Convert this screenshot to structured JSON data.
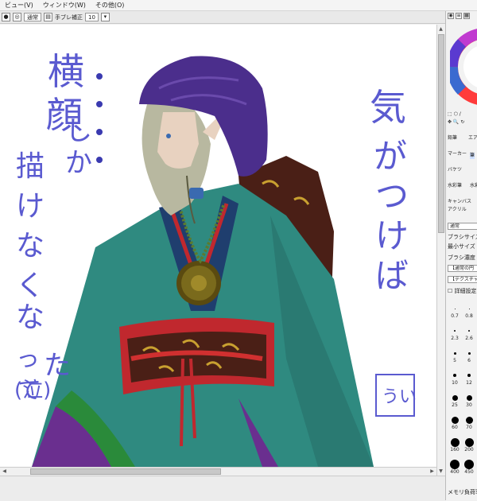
{
  "menu": {
    "items": [
      "ビュー(V)",
      "ウィンドウ(W)",
      "その他(O)"
    ]
  },
  "toolbar": {
    "blend_mode": "通常",
    "stabilizer_label": "手ブレ補正",
    "stabilizer_value": "10"
  },
  "canvas": {
    "left_text_col1": "横顔・・・",
    "left_text_col2": "しか・・・",
    "left_text_col3": "描けなくなってた",
    "left_text_col4": "(泣)",
    "right_text": "気がつけば",
    "signature": "うい"
  },
  "panel": {
    "tools": [
      {
        "label": "鉛筆"
      },
      {
        "label": "エア"
      },
      {
        "label": "マーカー"
      },
      {
        "label": "筆"
      },
      {
        "label": "バケツ"
      },
      {
        "label": "水彩筆"
      },
      {
        "label": "水彩"
      },
      {
        "label": "キャンバス"
      },
      {
        "label": "アクリル"
      }
    ],
    "blend_field": "通常",
    "brush_size_label": "ブラシサイズ",
    "min_size_label": "最小サイズ",
    "brush_density_label": "ブラシ濃度",
    "shape_field": "【通常の円",
    "texture_field": "【テクスチャ",
    "detail_label": "詳細設定",
    "sizes": [
      "0.7",
      "0.8",
      "2.3",
      "2.6",
      "5",
      "6",
      "10",
      "12",
      "25",
      "30",
      "60",
      "70",
      "160",
      "200",
      "400",
      "450"
    ],
    "memory_label": "メモリ負荷率"
  },
  "colors": {
    "menubar_bg": "#f4f4f4",
    "text_ink": "#3a3ab0",
    "turban": "#4b2e8c",
    "robe": "#2f8a80",
    "obi_red": "#c0282e",
    "obi_dark": "#4a1f16"
  }
}
